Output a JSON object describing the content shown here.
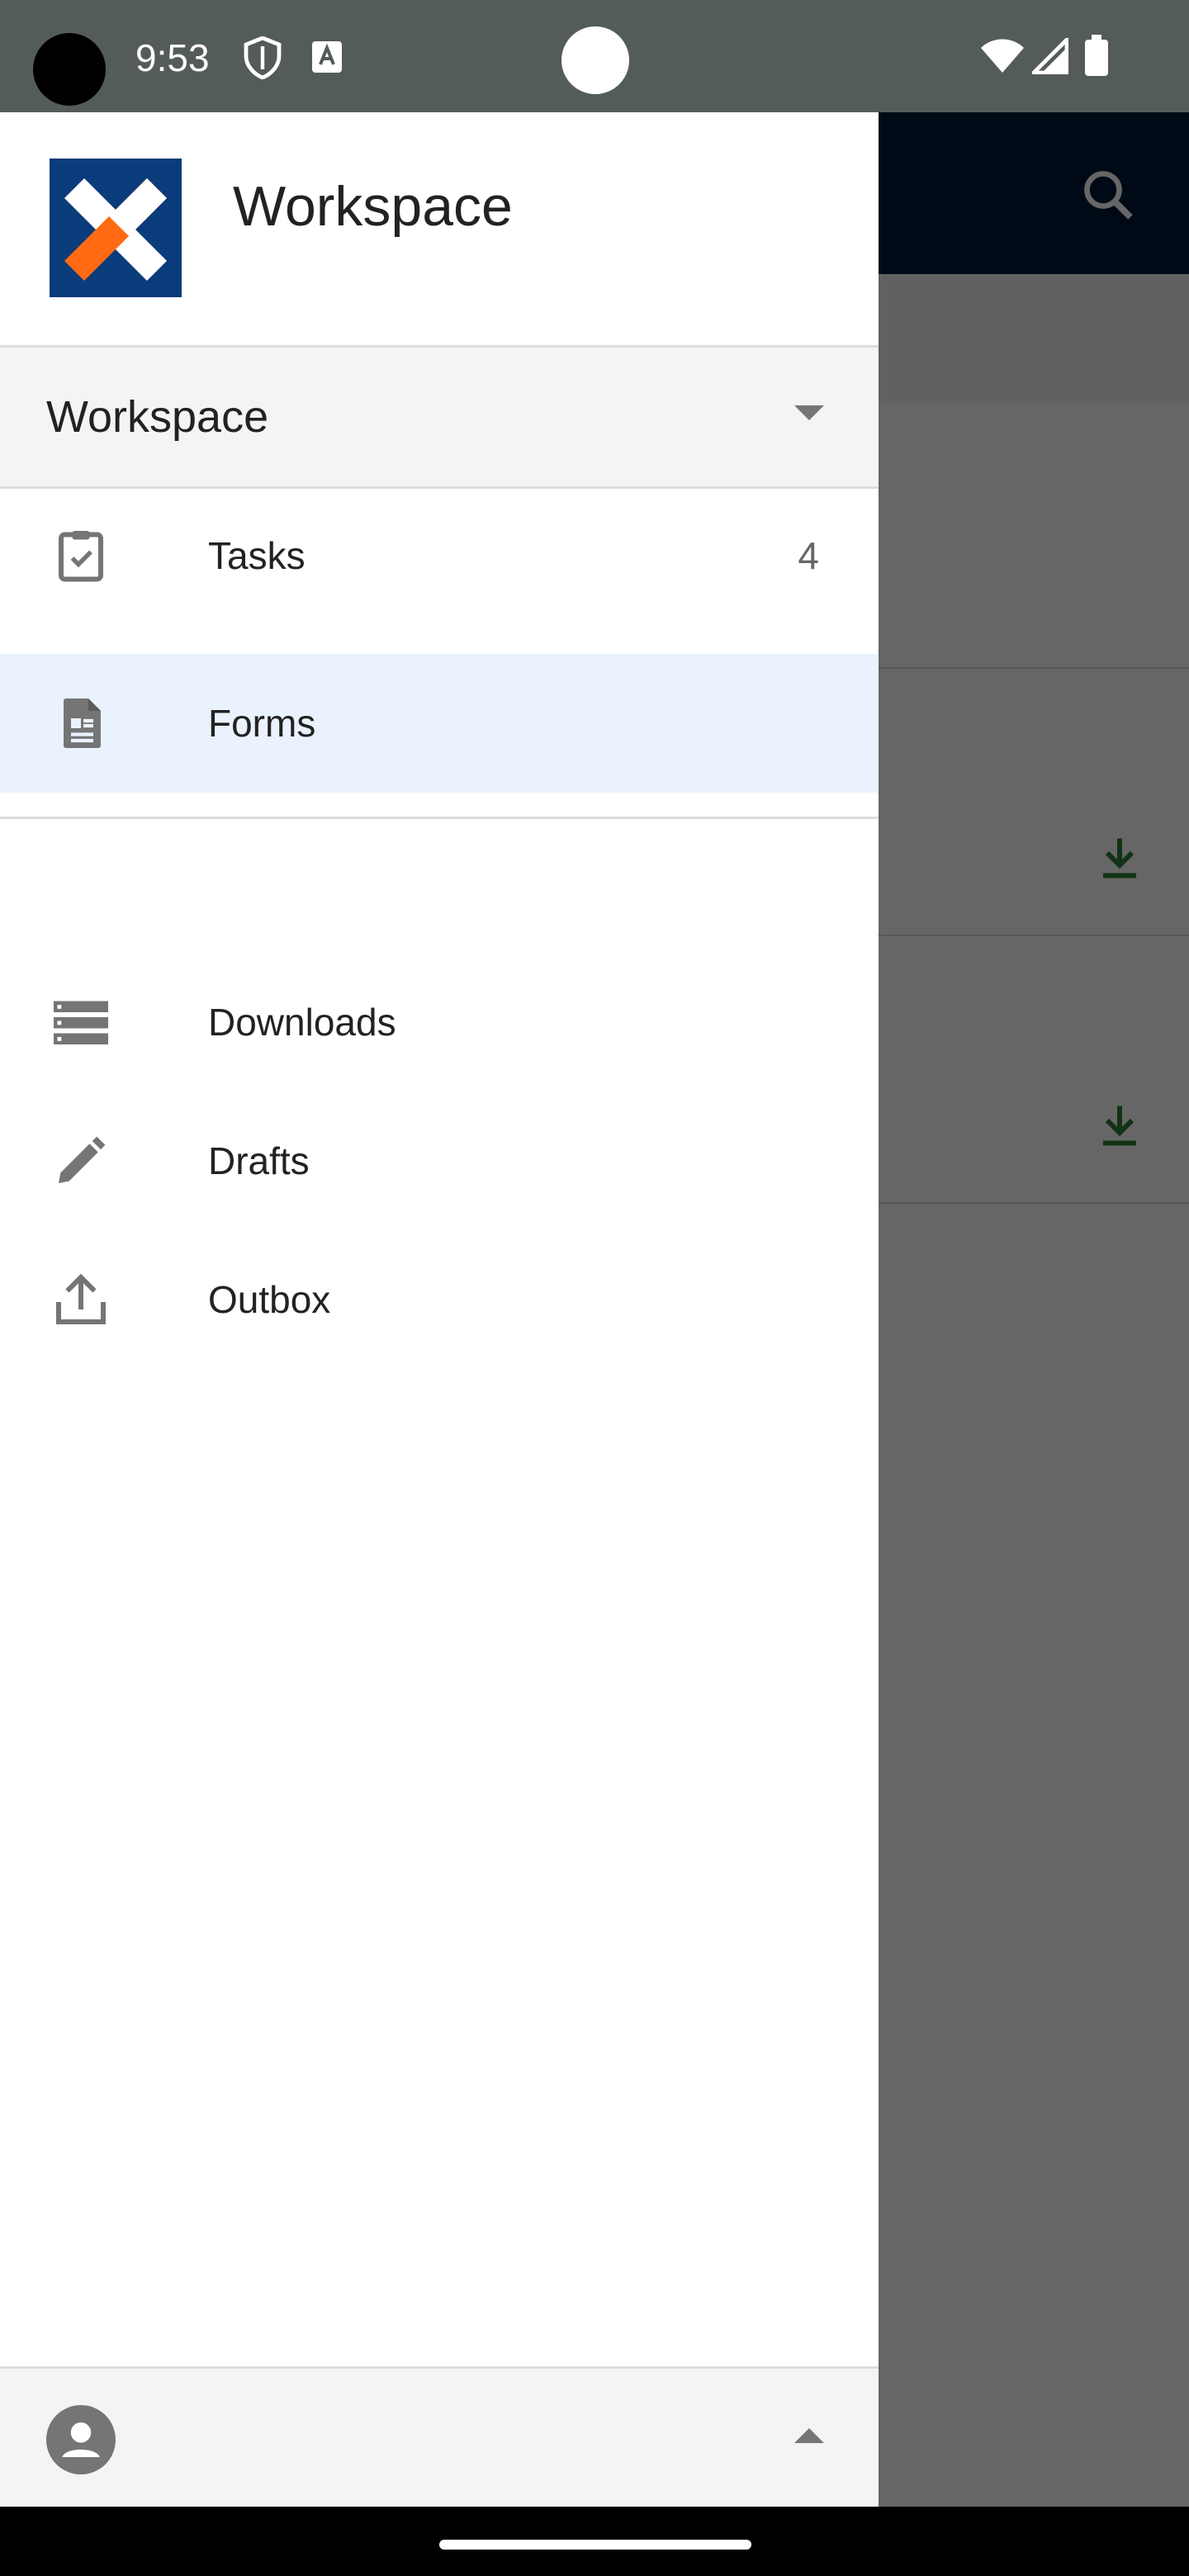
{
  "status_bar": {
    "time": "9:53"
  },
  "drawer": {
    "title": "Workspace",
    "workspace_selector": {
      "label": "Workspace"
    },
    "nav": [
      {
        "label": "Tasks",
        "icon": "clipboard-check-icon",
        "count": "4",
        "active": false
      },
      {
        "label": "Forms",
        "icon": "form-document-icon",
        "count": "",
        "active": true
      }
    ],
    "nav_secondary": [
      {
        "label": "Downloads",
        "icon": "downloads-list-icon"
      },
      {
        "label": "Drafts",
        "icon": "pencil-icon"
      },
      {
        "label": "Outbox",
        "icon": "upload-icon"
      }
    ]
  },
  "colors": {
    "status_bar": "#545b5b",
    "toolbar": "#001a3a",
    "active_item": "#eaf3fd",
    "logo_blue": "#0a3b7a",
    "logo_orange": "#ff6a13",
    "download_green": "#2e7d32"
  }
}
